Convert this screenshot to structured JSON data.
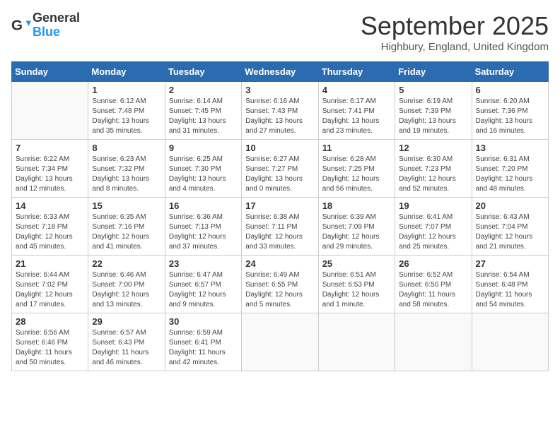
{
  "header": {
    "logo_general": "General",
    "logo_blue": "Blue",
    "month_title": "September 2025",
    "location": "Highbury, England, United Kingdom"
  },
  "calendar": {
    "days_of_week": [
      "Sunday",
      "Monday",
      "Tuesday",
      "Wednesday",
      "Thursday",
      "Friday",
      "Saturday"
    ],
    "weeks": [
      [
        {
          "day": "",
          "content": ""
        },
        {
          "day": "1",
          "content": "Sunrise: 6:12 AM\nSunset: 7:48 PM\nDaylight: 13 hours\nand 35 minutes."
        },
        {
          "day": "2",
          "content": "Sunrise: 6:14 AM\nSunset: 7:45 PM\nDaylight: 13 hours\nand 31 minutes."
        },
        {
          "day": "3",
          "content": "Sunrise: 6:16 AM\nSunset: 7:43 PM\nDaylight: 13 hours\nand 27 minutes."
        },
        {
          "day": "4",
          "content": "Sunrise: 6:17 AM\nSunset: 7:41 PM\nDaylight: 13 hours\nand 23 minutes."
        },
        {
          "day": "5",
          "content": "Sunrise: 6:19 AM\nSunset: 7:39 PM\nDaylight: 13 hours\nand 19 minutes."
        },
        {
          "day": "6",
          "content": "Sunrise: 6:20 AM\nSunset: 7:36 PM\nDaylight: 13 hours\nand 16 minutes."
        }
      ],
      [
        {
          "day": "7",
          "content": "Sunrise: 6:22 AM\nSunset: 7:34 PM\nDaylight: 13 hours\nand 12 minutes."
        },
        {
          "day": "8",
          "content": "Sunrise: 6:23 AM\nSunset: 7:32 PM\nDaylight: 13 hours\nand 8 minutes."
        },
        {
          "day": "9",
          "content": "Sunrise: 6:25 AM\nSunset: 7:30 PM\nDaylight: 13 hours\nand 4 minutes."
        },
        {
          "day": "10",
          "content": "Sunrise: 6:27 AM\nSunset: 7:27 PM\nDaylight: 13 hours\nand 0 minutes."
        },
        {
          "day": "11",
          "content": "Sunrise: 6:28 AM\nSunset: 7:25 PM\nDaylight: 12 hours\nand 56 minutes."
        },
        {
          "day": "12",
          "content": "Sunrise: 6:30 AM\nSunset: 7:23 PM\nDaylight: 12 hours\nand 52 minutes."
        },
        {
          "day": "13",
          "content": "Sunrise: 6:31 AM\nSunset: 7:20 PM\nDaylight: 12 hours\nand 48 minutes."
        }
      ],
      [
        {
          "day": "14",
          "content": "Sunrise: 6:33 AM\nSunset: 7:18 PM\nDaylight: 12 hours\nand 45 minutes."
        },
        {
          "day": "15",
          "content": "Sunrise: 6:35 AM\nSunset: 7:16 PM\nDaylight: 12 hours\nand 41 minutes."
        },
        {
          "day": "16",
          "content": "Sunrise: 6:36 AM\nSunset: 7:13 PM\nDaylight: 12 hours\nand 37 minutes."
        },
        {
          "day": "17",
          "content": "Sunrise: 6:38 AM\nSunset: 7:11 PM\nDaylight: 12 hours\nand 33 minutes."
        },
        {
          "day": "18",
          "content": "Sunrise: 6:39 AM\nSunset: 7:09 PM\nDaylight: 12 hours\nand 29 minutes."
        },
        {
          "day": "19",
          "content": "Sunrise: 6:41 AM\nSunset: 7:07 PM\nDaylight: 12 hours\nand 25 minutes."
        },
        {
          "day": "20",
          "content": "Sunrise: 6:43 AM\nSunset: 7:04 PM\nDaylight: 12 hours\nand 21 minutes."
        }
      ],
      [
        {
          "day": "21",
          "content": "Sunrise: 6:44 AM\nSunset: 7:02 PM\nDaylight: 12 hours\nand 17 minutes."
        },
        {
          "day": "22",
          "content": "Sunrise: 6:46 AM\nSunset: 7:00 PM\nDaylight: 12 hours\nand 13 minutes."
        },
        {
          "day": "23",
          "content": "Sunrise: 6:47 AM\nSunset: 6:57 PM\nDaylight: 12 hours\nand 9 minutes."
        },
        {
          "day": "24",
          "content": "Sunrise: 6:49 AM\nSunset: 6:55 PM\nDaylight: 12 hours\nand 5 minutes."
        },
        {
          "day": "25",
          "content": "Sunrise: 6:51 AM\nSunset: 6:53 PM\nDaylight: 12 hours\nand 1 minute."
        },
        {
          "day": "26",
          "content": "Sunrise: 6:52 AM\nSunset: 6:50 PM\nDaylight: 11 hours\nand 58 minutes."
        },
        {
          "day": "27",
          "content": "Sunrise: 6:54 AM\nSunset: 6:48 PM\nDaylight: 11 hours\nand 54 minutes."
        }
      ],
      [
        {
          "day": "28",
          "content": "Sunrise: 6:56 AM\nSunset: 6:46 PM\nDaylight: 11 hours\nand 50 minutes."
        },
        {
          "day": "29",
          "content": "Sunrise: 6:57 AM\nSunset: 6:43 PM\nDaylight: 11 hours\nand 46 minutes."
        },
        {
          "day": "30",
          "content": "Sunrise: 6:59 AM\nSunset: 6:41 PM\nDaylight: 11 hours\nand 42 minutes."
        },
        {
          "day": "",
          "content": ""
        },
        {
          "day": "",
          "content": ""
        },
        {
          "day": "",
          "content": ""
        },
        {
          "day": "",
          "content": ""
        }
      ]
    ]
  }
}
